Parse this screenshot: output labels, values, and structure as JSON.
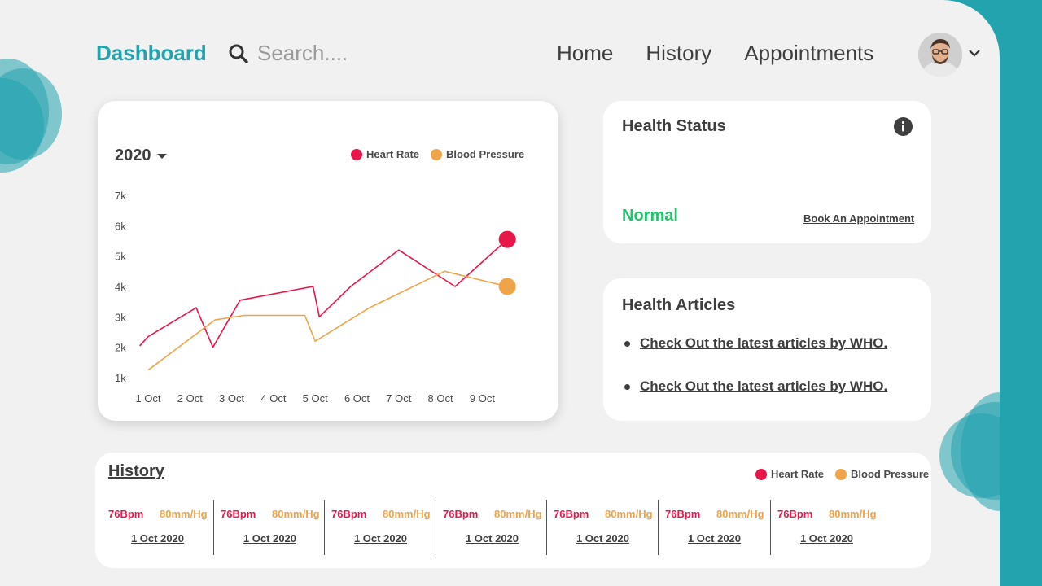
{
  "colors": {
    "teal": "#23a3ae",
    "heart_rate": "#e8174a",
    "blood_pressure": "#f0a449",
    "normal": "#1ec46a"
  },
  "header": {
    "brand": "Dashboard",
    "search_placeholder": "Search....",
    "search_icon": "search-icon",
    "nav": [
      "Home",
      "History",
      "Appointments"
    ],
    "avatar_menu_icon": "chevron-down-icon"
  },
  "chart_card": {
    "year": "2020",
    "year_icon": "caret-down-icon",
    "legend": [
      "Heart Rate",
      "Blood Pressure"
    ]
  },
  "chart_data": {
    "type": "line",
    "x": [
      "1 Oct",
      "2 Oct",
      "3 Oct",
      "4 Oct",
      "5 Oct",
      "6 Oct",
      "7 Oct",
      "8 Oct",
      "9 Oct"
    ],
    "y_ticks": [
      "7k",
      "6k",
      "5k",
      "4k",
      "3k",
      "2k",
      "1k"
    ],
    "ylim": [
      1000,
      7000
    ],
    "legend_position": "top-right",
    "grid": false,
    "series": [
      {
        "name": "Heart Rate",
        "color": "#e8174a",
        "points": [
          [
            0.8,
            2050
          ],
          [
            1.0,
            2350
          ],
          [
            2.15,
            3300
          ],
          [
            2.55,
            2000
          ],
          [
            3.2,
            3550
          ],
          [
            4.95,
            4000
          ],
          [
            5.1,
            3000
          ],
          [
            5.85,
            4000
          ],
          [
            7.0,
            5200
          ],
          [
            8.35,
            4000
          ],
          [
            9.6,
            5550
          ]
        ]
      },
      {
        "name": "Blood Pressure",
        "color": "#f0a449",
        "points": [
          [
            1.0,
            1250
          ],
          [
            2.6,
            2900
          ],
          [
            3.3,
            3050
          ],
          [
            4.75,
            3050
          ],
          [
            5.0,
            2200
          ],
          [
            6.3,
            3300
          ],
          [
            8.1,
            4500
          ],
          [
            9.6,
            4000
          ]
        ]
      }
    ]
  },
  "health_status": {
    "title": "Health Status",
    "info_icon": "info-icon",
    "status": "Normal",
    "book_link": "Book An Appointment"
  },
  "health_articles": {
    "title": "Health Articles",
    "items": [
      "Check Out the latest articles by WHO.",
      "Check Out the latest articles by WHO."
    ]
  },
  "history": {
    "title": "History",
    "legend": [
      "Heart Rate",
      "Blood Pressure"
    ],
    "entries": [
      {
        "bpm": "76Bpm",
        "bp": "80mm/Hg",
        "date": "1 Oct 2020"
      },
      {
        "bpm": "76Bpm",
        "bp": "80mm/Hg",
        "date": "1 Oct 2020"
      },
      {
        "bpm": "76Bpm",
        "bp": "80mm/Hg",
        "date": "1 Oct 2020"
      },
      {
        "bpm": "76Bpm",
        "bp": "80mm/Hg",
        "date": "1 Oct 2020"
      },
      {
        "bpm": "76Bpm",
        "bp": "80mm/Hg",
        "date": "1 Oct 2020"
      },
      {
        "bpm": "76Bpm",
        "bp": "80mm/Hg",
        "date": "1 Oct 2020"
      },
      {
        "bpm": "76Bpm",
        "bp": "80mm/Hg",
        "date": "1 Oct 2020"
      }
    ]
  }
}
